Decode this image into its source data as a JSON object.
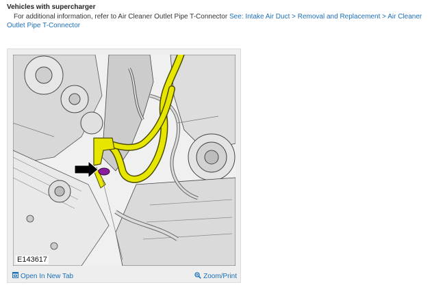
{
  "section": {
    "heading": "Vehicles with supercharger",
    "info_prefix": "For additional information, refer to Air Cleaner Outlet Pipe T-Connector ",
    "info_link": "See: Intake Air Duct > Removal and Replacement > Air Cleaner Outlet Pipe T-Connector"
  },
  "figure": {
    "id": "E143617",
    "open_new_tab": "Open In New Tab",
    "zoom_print": "Zoom/Print"
  },
  "colors": {
    "link": "#1b6fb8",
    "highlight_pipe": "#e6e600",
    "highlight_connector": "#8a1f9e",
    "arrow": "#000000"
  },
  "icons": {
    "open_new_tab": "open-new-tab-icon",
    "zoom_print": "magnifier-icon"
  }
}
